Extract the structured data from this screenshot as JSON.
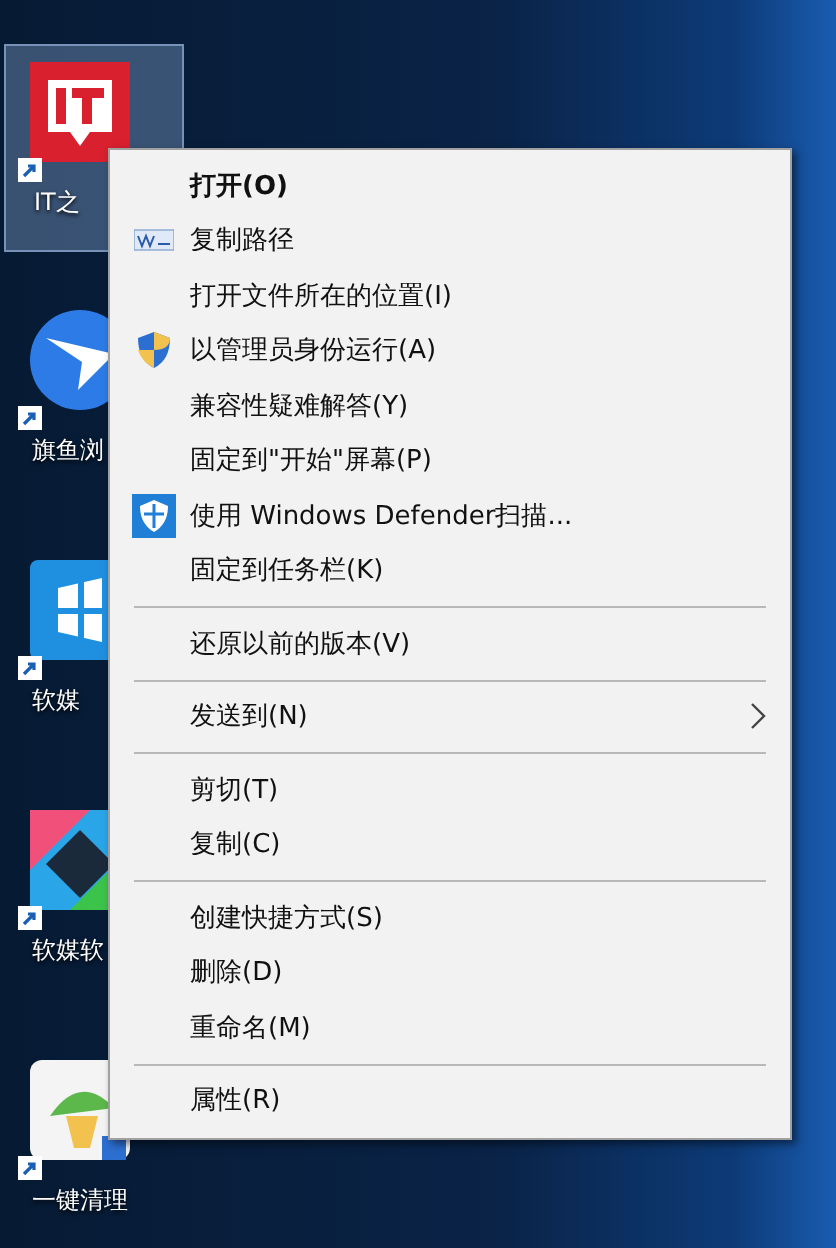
{
  "desktop_icons": [
    {
      "label": "IT之",
      "kind": "it",
      "selected": true
    },
    {
      "label": "旗鱼浏",
      "kind": "browser",
      "selected": false
    },
    {
      "label": "软媒",
      "kind": "cube",
      "selected": false
    },
    {
      "label": "软媒软",
      "kind": "software",
      "selected": false
    },
    {
      "label": "一键清理",
      "kind": "cleaner",
      "selected": false
    }
  ],
  "context_menu": [
    {
      "kind": "default",
      "label": "打开(O)"
    },
    {
      "kind": "copy-path",
      "label": "复制路径"
    },
    {
      "kind": "item",
      "label": "打开文件所在的位置(I)"
    },
    {
      "kind": "run-as-admin",
      "label": "以管理员身份运行(A)"
    },
    {
      "kind": "item",
      "label": "兼容性疑难解答(Y)"
    },
    {
      "kind": "item",
      "label": "固定到\"开始\"屏幕(P)"
    },
    {
      "kind": "scan",
      "label": "使用 Windows Defender扫描..."
    },
    {
      "kind": "item",
      "label": "固定到任务栏(K)"
    },
    {
      "kind": "separator"
    },
    {
      "kind": "item",
      "label": "还原以前的版本(V)"
    },
    {
      "kind": "separator"
    },
    {
      "kind": "submenu",
      "label": "发送到(N)"
    },
    {
      "kind": "separator"
    },
    {
      "kind": "item",
      "label": "剪切(T)"
    },
    {
      "kind": "item",
      "label": "复制(C)"
    },
    {
      "kind": "separator"
    },
    {
      "kind": "item",
      "label": "创建快捷方式(S)"
    },
    {
      "kind": "item",
      "label": "删除(D)"
    },
    {
      "kind": "item",
      "label": "重命名(M)"
    },
    {
      "kind": "separator"
    },
    {
      "kind": "item",
      "label": "属性(R)"
    }
  ]
}
